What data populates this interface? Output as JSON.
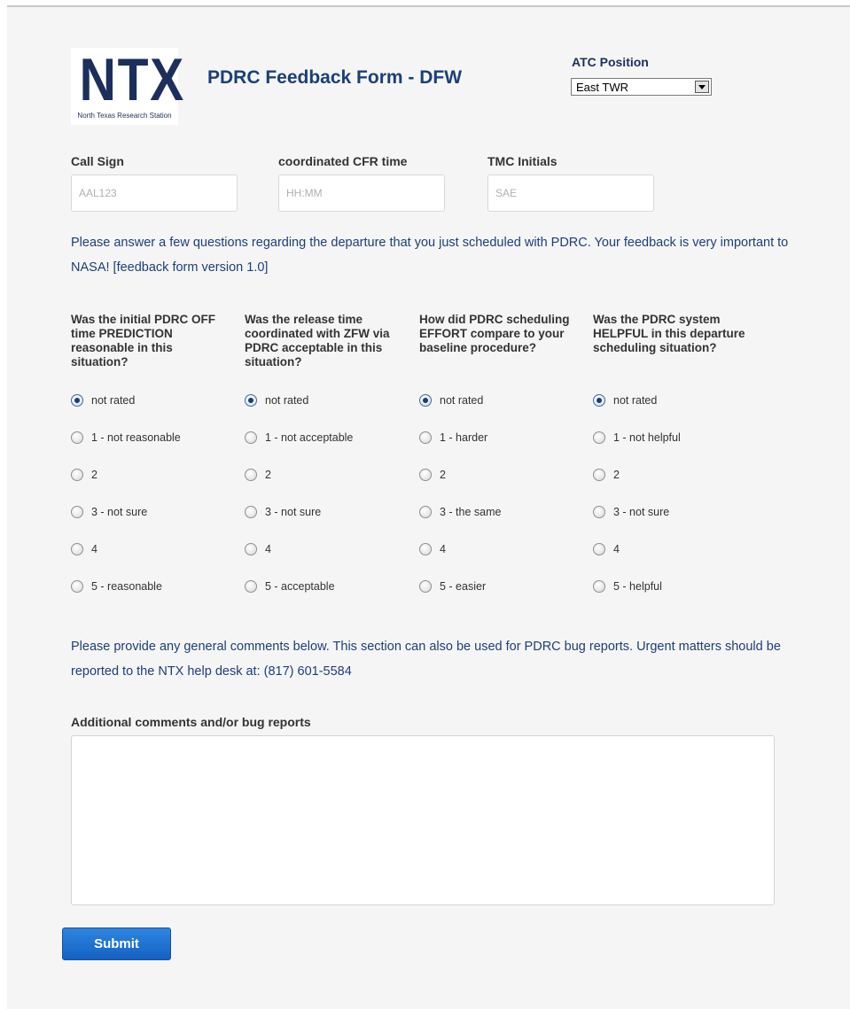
{
  "logo": {
    "word": "NTX",
    "subtitle": "North Texas Research Station"
  },
  "header": {
    "title": "PDRC Feedback Form - DFW"
  },
  "atc_position": {
    "label": "ATC Position",
    "selected": "East TWR"
  },
  "fields": {
    "call_sign": {
      "label": "Call Sign",
      "placeholder": "AAL123"
    },
    "cfr_time": {
      "label": "coordinated CFR time",
      "placeholder": "HH:MM"
    },
    "tmc_initials": {
      "label": "TMC Initials",
      "placeholder": "SAE"
    }
  },
  "intro_text": "Please answer a few questions regarding the departure that you just scheduled with PDRC. Your feedback is very important to NASA! [feedback form version 1.0]",
  "questions": [
    {
      "text": "Was the initial PDRC OFF time PREDICTION reasonable in this situation?",
      "options": [
        "not rated",
        "1 - not reasonable",
        "2",
        "3 - not sure",
        "4",
        "5 - reasonable"
      ],
      "selected": 0
    },
    {
      "text": "Was the release time coordinated with ZFW via PDRC acceptable in this situation?",
      "options": [
        "not rated",
        "1 - not acceptable",
        "2",
        "3 - not sure",
        "4",
        "5 - acceptable"
      ],
      "selected": 0
    },
    {
      "text": "How did PDRC scheduling EFFORT compare to your baseline procedure?",
      "options": [
        "not rated",
        "1 - harder",
        "2",
        "3 - the same",
        "4",
        "5 - easier"
      ],
      "selected": 0
    },
    {
      "text": "Was the PDRC system HELPFUL in this departure scheduling situation?",
      "options": [
        "not rated",
        "1 - not helpful",
        "2",
        "3 - not sure",
        "4",
        "5 - helpful"
      ],
      "selected": 0
    }
  ],
  "comments_intro": "Please provide any general comments below. This section can also be used for PDRC bug reports. Urgent matters should be reported to the NTX help desk at: (817) 601-5584",
  "comments": {
    "label": "Additional comments and/or bug reports",
    "value": ""
  },
  "submit_label": "Submit",
  "colors": {
    "accent_blue": "#1c3f77",
    "button_blue": "#1f6fd0",
    "background": "#f5f5f5"
  }
}
